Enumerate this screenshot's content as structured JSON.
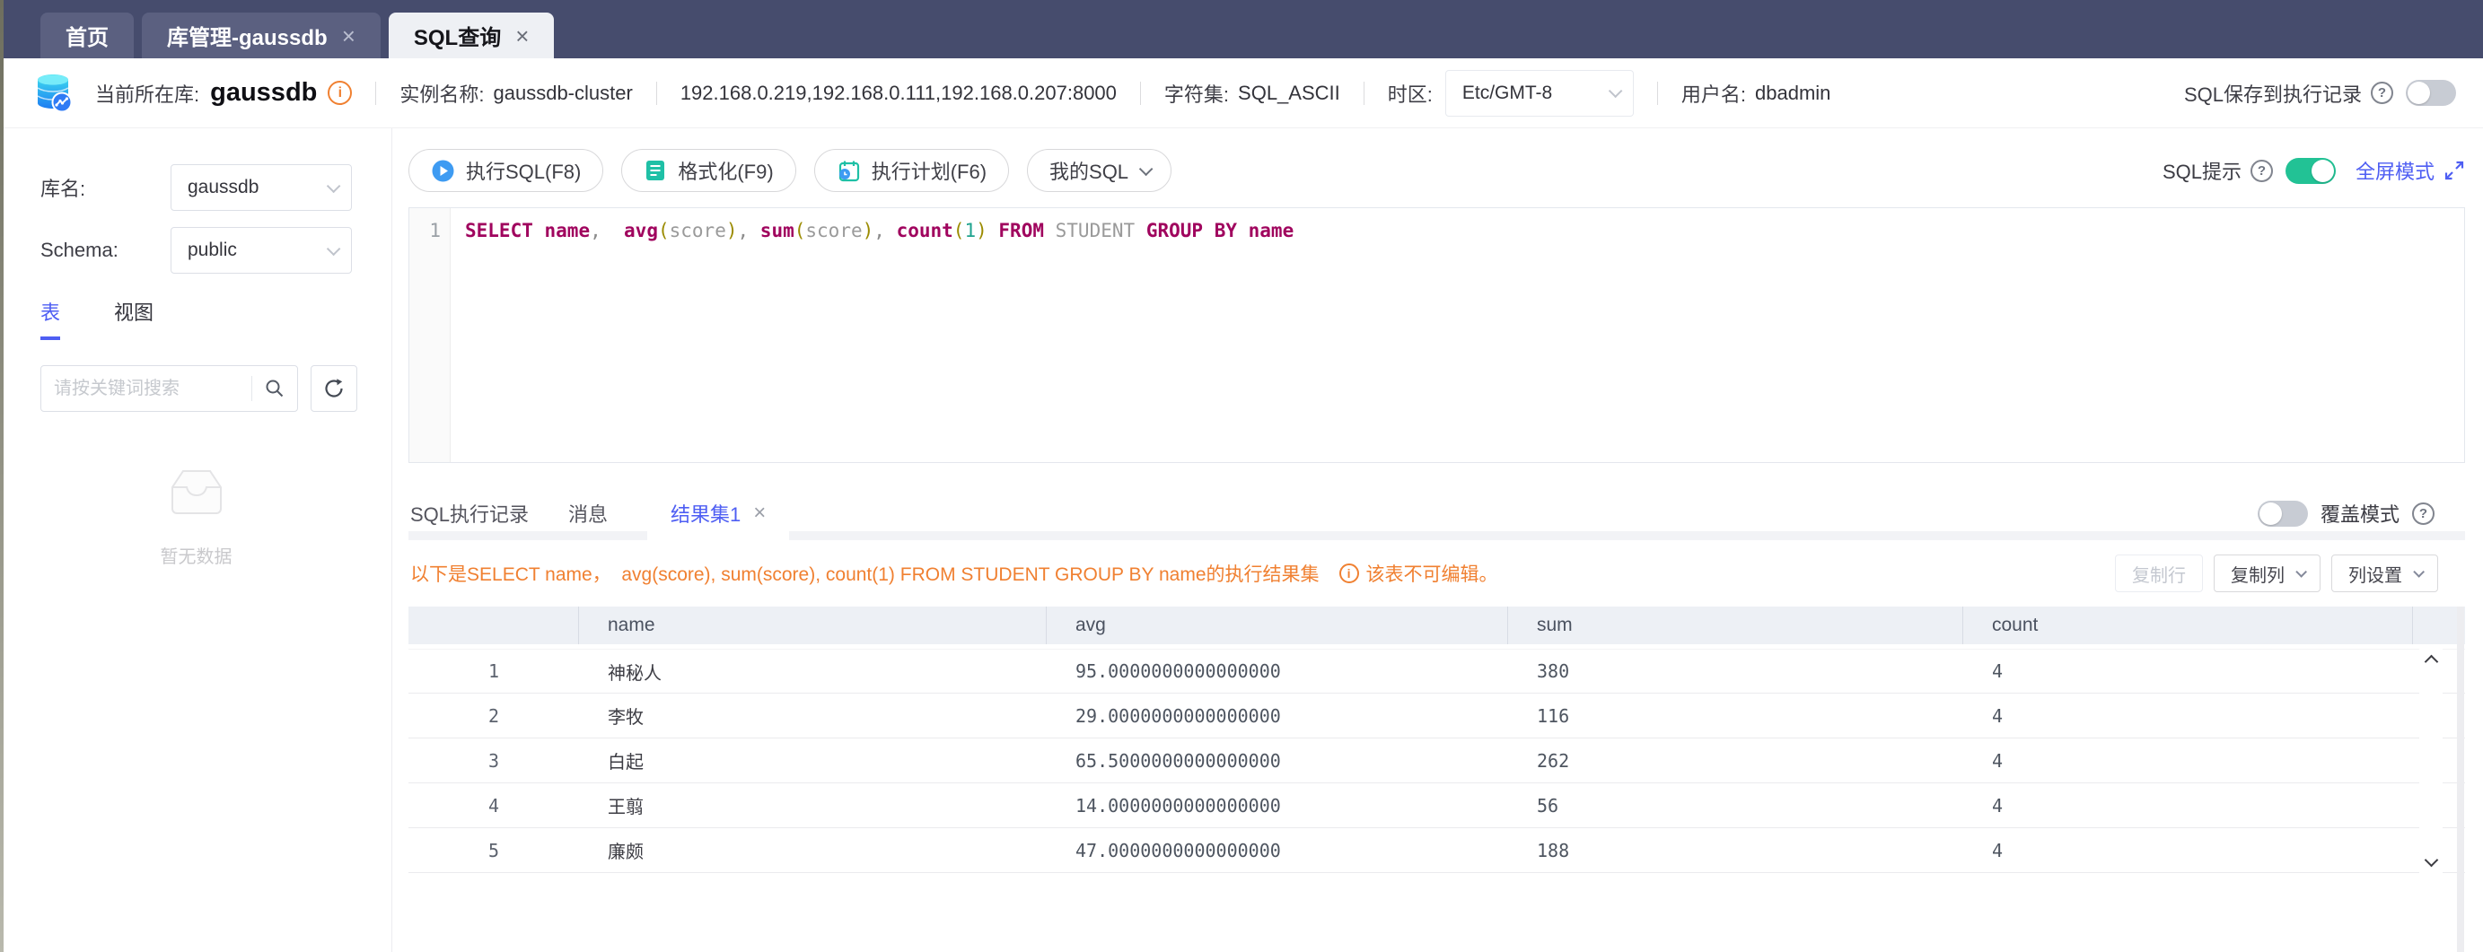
{
  "colors": {
    "tabbar_bg": "#464c6d",
    "tab_inactive_bg": "#5b6080",
    "tab_active_bg": "#eef0f4",
    "accent_blue": "#4e5ef3",
    "toggle_on_green": "#22c295",
    "toggle_off_gray": "#c8ccd4",
    "warning_orange": "#f08031",
    "table_header_bg": "#edf0f5",
    "sql_keyword": "#a0045e",
    "sql_bracket": "#9b8b00",
    "sql_identifier": "#9a9a9a",
    "sql_number": "#1fa38e",
    "icon_teal": "#1fc0a6",
    "icon_blue": "#3e9bf2"
  },
  "icons": [
    "database-logo-icon",
    "info-icon",
    "question-icon",
    "chevron-down-icon",
    "search-icon",
    "refresh-icon",
    "empty-box-icon",
    "play-icon",
    "format-icon",
    "plan-icon",
    "fullscreen-icon",
    "close-icon",
    "scroll-up-icon",
    "scroll-down-icon"
  ],
  "window_tabs": [
    {
      "label": "首页",
      "closable": false,
      "active": false
    },
    {
      "label": "库管理-gaussdb",
      "closable": true,
      "active": false
    },
    {
      "label": "SQL查询",
      "closable": true,
      "active": true
    }
  ],
  "header": {
    "current_db_label": "当前所在库:",
    "current_db": "gaussdb",
    "instance_label": "实例名称:",
    "instance_name": "gaussdb-cluster",
    "addresses": "192.168.0.219,192.168.0.111,192.168.0.207:8000",
    "charset_label": "字符集:",
    "charset": "SQL_ASCII",
    "timezone_label": "时区:",
    "timezone_value": "Etc/GMT-8",
    "username_label": "用户名:",
    "username": "dbadmin",
    "save_history_label": "SQL保存到执行记录",
    "save_history_on": false
  },
  "sidebar": {
    "db_label": "库名:",
    "db_value": "gaussdb",
    "schema_label": "Schema:",
    "schema_value": "public",
    "tabs": [
      {
        "label": "表",
        "active": true
      },
      {
        "label": "视图",
        "active": false
      }
    ],
    "search_placeholder": "请按关键词搜索",
    "empty_text": "暂无数据"
  },
  "toolbar": {
    "run_sql_label": "执行SQL(F8)",
    "format_label": "格式化(F9)",
    "explain_label": "执行计划(F6)",
    "my_sql_label": "我的SQL",
    "sql_hint_label": "SQL提示",
    "sql_hint_on": true,
    "fullscreen_label": "全屏模式"
  },
  "editor": {
    "line_number": "1",
    "sql_text": "SELECT name,  avg(score), sum(score), count(1) FROM STUDENT GROUP BY name",
    "tokens": [
      {
        "t": "SELECT",
        "c": "kw"
      },
      {
        "t": " ",
        "c": "pl"
      },
      {
        "t": "name",
        "c": "kw"
      },
      {
        "t": ",  ",
        "c": "pl"
      },
      {
        "t": "avg",
        "c": "kw"
      },
      {
        "t": "(",
        "c": "br"
      },
      {
        "t": "score",
        "c": "id"
      },
      {
        "t": ")",
        "c": "br"
      },
      {
        "t": ", ",
        "c": "pl"
      },
      {
        "t": "sum",
        "c": "kw"
      },
      {
        "t": "(",
        "c": "br"
      },
      {
        "t": "score",
        "c": "id"
      },
      {
        "t": ")",
        "c": "br"
      },
      {
        "t": ", ",
        "c": "pl"
      },
      {
        "t": "count",
        "c": "kw"
      },
      {
        "t": "(",
        "c": "br"
      },
      {
        "t": "1",
        "c": "num"
      },
      {
        "t": ")",
        "c": "br"
      },
      {
        "t": " ",
        "c": "pl"
      },
      {
        "t": "FROM",
        "c": "kw"
      },
      {
        "t": " ",
        "c": "pl"
      },
      {
        "t": "STUDENT",
        "c": "id"
      },
      {
        "t": " ",
        "c": "pl"
      },
      {
        "t": "GROUP",
        "c": "kw"
      },
      {
        "t": " ",
        "c": "pl"
      },
      {
        "t": "BY",
        "c": "kw"
      },
      {
        "t": " ",
        "c": "pl"
      },
      {
        "t": "name",
        "c": "kw"
      }
    ]
  },
  "results": {
    "tabs": [
      {
        "label": "SQL执行记录",
        "active": false,
        "closable": false
      },
      {
        "label": "消息",
        "active": false,
        "closable": false
      },
      {
        "label": "结果集1",
        "active": true,
        "closable": true
      }
    ],
    "overwrite_label": "覆盖模式",
    "overwrite_on": false,
    "message": "以下是SELECT name，  avg(score), sum(score), count(1) FROM STUDENT GROUP BY name的执行结果集",
    "readonly_note": "该表不可编辑。",
    "copy_row_label": "复制行",
    "copy_row_enabled": false,
    "copy_col_label": "复制列",
    "col_settings_label": "列设置",
    "columns": [
      "name",
      "avg",
      "sum",
      "count"
    ],
    "rows": [
      {
        "index": "1",
        "name": "神秘人",
        "avg": "95.0000000000000000",
        "sum": "380",
        "count": "4"
      },
      {
        "index": "2",
        "name": "李牧",
        "avg": "29.0000000000000000",
        "sum": "116",
        "count": "4"
      },
      {
        "index": "3",
        "name": "白起",
        "avg": "65.5000000000000000",
        "sum": "262",
        "count": "4"
      },
      {
        "index": "4",
        "name": "王翦",
        "avg": "14.0000000000000000",
        "sum": "56",
        "count": "4"
      },
      {
        "index": "5",
        "name": "廉颇",
        "avg": "47.0000000000000000",
        "sum": "188",
        "count": "4"
      }
    ]
  }
}
